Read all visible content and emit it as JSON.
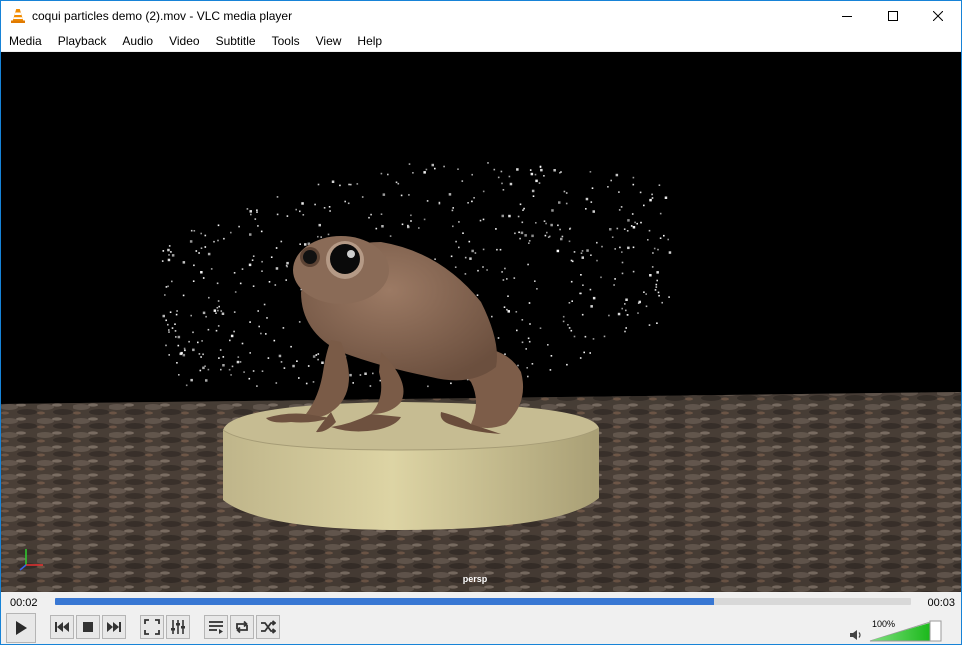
{
  "window": {
    "title": "coqui particles demo (2).mov - VLC media player",
    "app_icon": "vlc-cone-icon",
    "buttons": [
      "minimize-icon",
      "maximize-icon",
      "close-icon"
    ]
  },
  "menubar": {
    "items": [
      "Media",
      "Playback",
      "Audio",
      "Video",
      "Subtitle",
      "Tools",
      "View",
      "Help"
    ]
  },
  "video": {
    "overlay_label": "persp"
  },
  "seek": {
    "elapsed": "00:02",
    "total": "00:03",
    "progress": 0.77
  },
  "controls": {
    "buttons": [
      {
        "name": "play-button",
        "icon": "play-icon"
      },
      {
        "name": "previous-button",
        "icon": "skip-back-icon"
      },
      {
        "name": "stop-button",
        "icon": "stop-icon"
      },
      {
        "name": "next-button",
        "icon": "skip-forward-icon"
      },
      {
        "name": "fullscreen-button",
        "icon": "fullscreen-icon"
      },
      {
        "name": "extended-settings-button",
        "icon": "equalizer-icon"
      },
      {
        "name": "playlist-button",
        "icon": "playlist-icon"
      },
      {
        "name": "loop-button",
        "icon": "loop-icon"
      },
      {
        "name": "shuffle-button",
        "icon": "shuffle-icon"
      }
    ]
  },
  "volume": {
    "percent_label": "100%",
    "level": 1.0,
    "icon": "speaker-icon"
  },
  "colors": {
    "accent": "#3877d3",
    "window_border": "#1783d7",
    "vlc_orange": "#f28c00",
    "volume_green": "#2ec42e"
  }
}
